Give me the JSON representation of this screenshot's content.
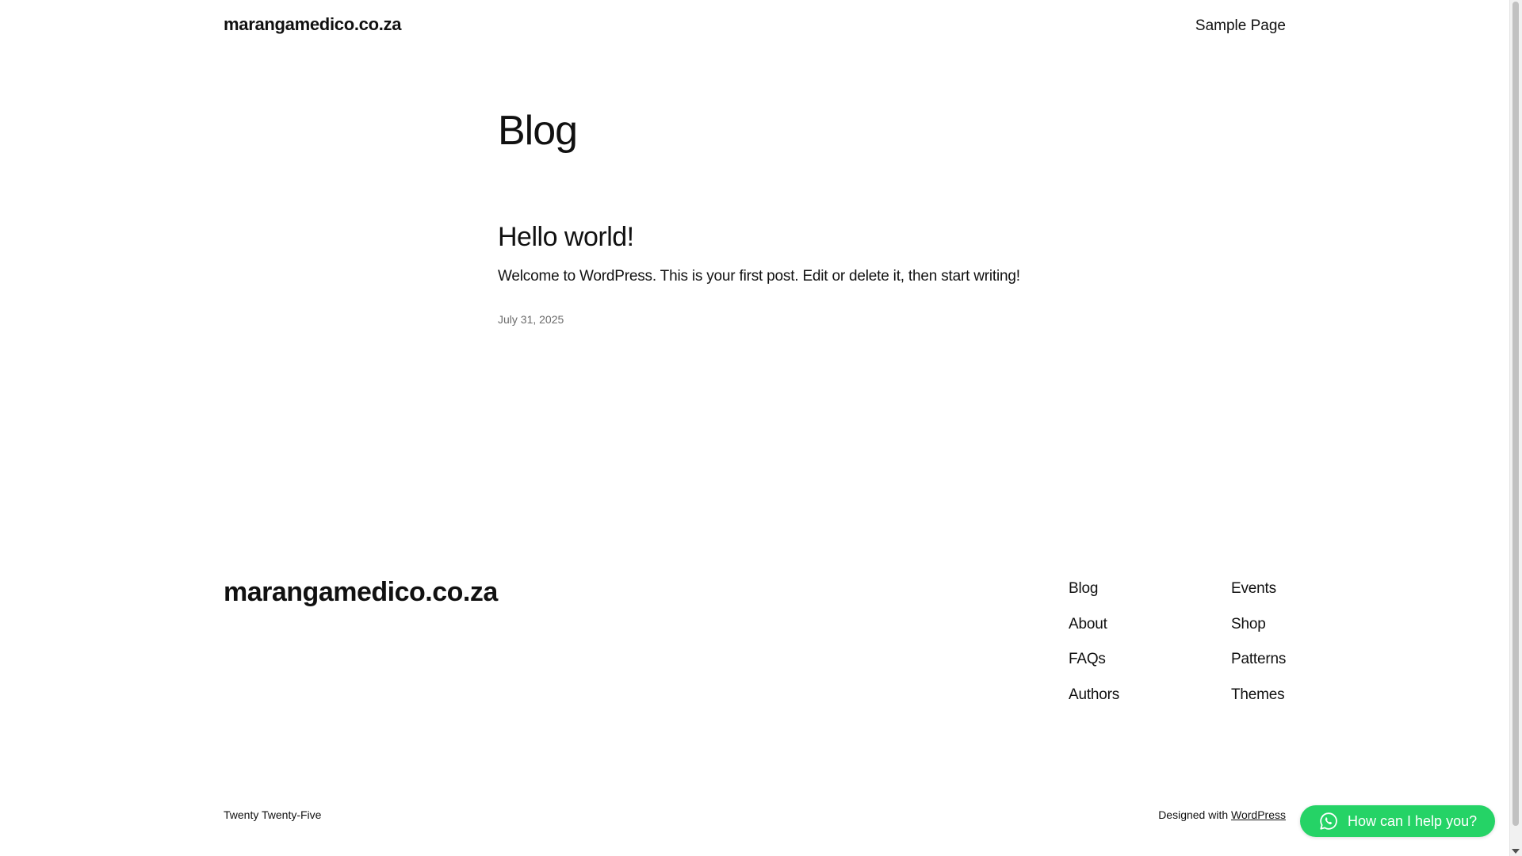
{
  "header": {
    "site_title": "marangamedico.co.za",
    "nav": {
      "sample_page": "Sample Page"
    }
  },
  "main": {
    "heading": "Blog",
    "posts": [
      {
        "title": "Hello world!",
        "excerpt": "Welcome to WordPress. This is your first post. Edit or delete it, then start writing!",
        "date": "July 31, 2025"
      }
    ]
  },
  "footer": {
    "site_title": "marangamedico.co.za",
    "nav_col1": [
      "Blog",
      "About",
      "FAQs",
      "Authors"
    ],
    "nav_col2": [
      "Events",
      "Shop",
      "Patterns",
      "Themes"
    ],
    "theme_credit": "Twenty Twenty-Five",
    "designed_with_prefix": "Designed with",
    "designed_with_link": "WordPress"
  },
  "chat_widget": {
    "label": "How can I help you?",
    "icon": "whatsapp-icon",
    "color": "#25d366"
  },
  "colors": {
    "text": "#111111",
    "muted": "#6b6b6b",
    "background": "#ffffff"
  }
}
